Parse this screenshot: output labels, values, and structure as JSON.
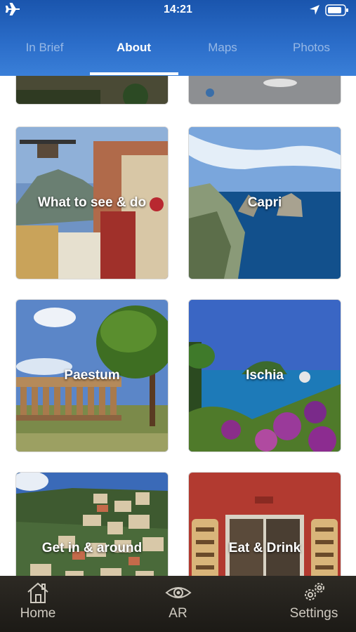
{
  "status_bar": {
    "time": "14:21",
    "icons": [
      "airplane-mode-icon",
      "location-arrow-icon",
      "battery-icon"
    ]
  },
  "tabs": [
    {
      "label": "In Brief",
      "active": false
    },
    {
      "label": "About",
      "active": true
    },
    {
      "label": "Maps",
      "active": false
    },
    {
      "label": "Photos",
      "active": false
    }
  ],
  "tiles": [
    {
      "label": "What to see & do"
    },
    {
      "label": "Capri"
    },
    {
      "label": "Paestum"
    },
    {
      "label": "Ischia"
    },
    {
      "label": "Get in & around"
    },
    {
      "label": "Eat & Drink"
    }
  ],
  "bottom_nav": [
    {
      "label": "Home",
      "icon": "home-icon"
    },
    {
      "label": "AR",
      "icon": "eye-icon"
    },
    {
      "label": "Settings",
      "icon": "gears-icon"
    }
  ],
  "colors": {
    "header": "#2a6cc8",
    "tab_inactive": "rgba(255,255,255,0.5)",
    "bottom_bar": "#24211c"
  }
}
